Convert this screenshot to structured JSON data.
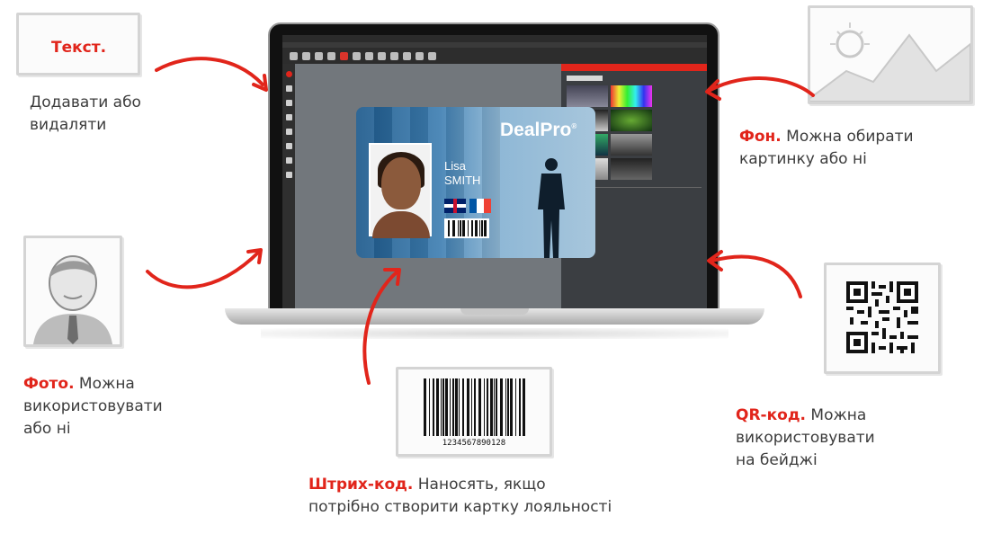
{
  "laptop_screen": {
    "card": {
      "brand": "DealPro",
      "brand_mark": "®",
      "first_name": "Lisa",
      "last_name": "SMITH"
    }
  },
  "callouts": {
    "text": {
      "keyword": "Текст.",
      "line1": "Додавати або",
      "line2": "видаляти"
    },
    "background": {
      "keyword": "Фон.",
      "rest": " Можна обирати",
      "line2": "картинку або ні"
    },
    "photo": {
      "keyword": "Фото.",
      "rest": " Можна",
      "line2": "використовувати",
      "line3": "або ні"
    },
    "qr": {
      "keyword": "QR-код.",
      "rest": " Можна",
      "line2": "використовувати",
      "line3": "на бейджі"
    },
    "barcode": {
      "keyword": "Штрих-код.",
      "rest": " Наносять, якщо",
      "line2": "потрібно створити картку лояльності",
      "digits": "1234567890128"
    }
  },
  "colors": {
    "accent": "#e1251b",
    "text": "#3c3c3c",
    "frame": "#d4d4d4"
  }
}
